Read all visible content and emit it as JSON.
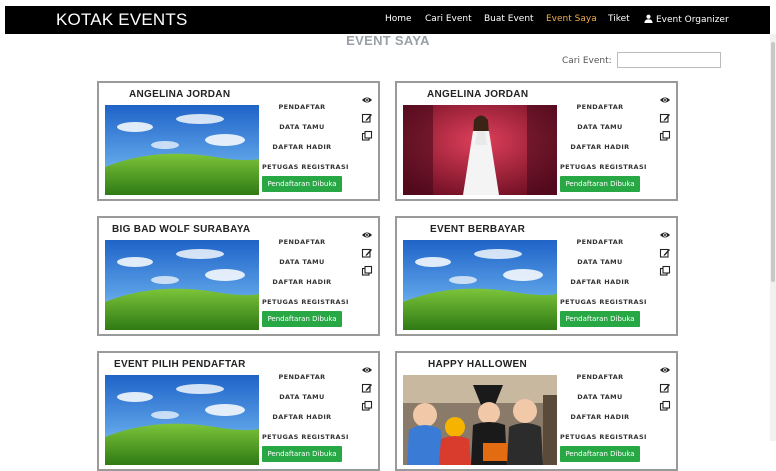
{
  "navbar": {
    "brand": "KOTAK EVENTS",
    "links": [
      {
        "label": "Home",
        "active": false
      },
      {
        "label": "Cari Event",
        "active": false
      },
      {
        "label": "Buat Event",
        "active": false
      },
      {
        "label": "Event Saya",
        "active": true
      },
      {
        "label": "Tiket",
        "active": false
      },
      {
        "label": "Event Organizer",
        "active": false
      }
    ],
    "active_color": "#f0ad4e"
  },
  "page": {
    "title": "EVENT SAYA",
    "search_label": "Cari Event:",
    "search_value": ""
  },
  "card_menu": [
    "PENDAFTAR",
    "DATA TAMU",
    "DAFTAR HADIR",
    "PETUGAS REGISTRASI"
  ],
  "card_icons": [
    "eye-icon",
    "edit-icon",
    "copy-icon"
  ],
  "events": [
    {
      "title": "ANGELINA JORDAN",
      "image": "landscape",
      "status": "Pendaftaran Dibuka"
    },
    {
      "title": "ANGELINA JORDAN",
      "image": "singer",
      "status": "Pendaftaran Dibuka"
    },
    {
      "title": "BIG BAD WOLF SURABAYA",
      "image": "landscape",
      "status": "Pendaftaran Dibuka"
    },
    {
      "title": "EVENT BERBAYAR",
      "image": "landscape",
      "status": "Pendaftaran Dibuka"
    },
    {
      "title": "EVENT PILIH PENDAFTAR",
      "image": "landscape",
      "status": "Pendaftaran Dibuka"
    },
    {
      "title": "HAPPY HALLOWEN",
      "image": "halloween",
      "status": "Pendaftaran Dibuka"
    }
  ],
  "colors": {
    "status_green": "#28a745",
    "card_border": "#9a9a9a",
    "navbar_bg": "#000000"
  }
}
